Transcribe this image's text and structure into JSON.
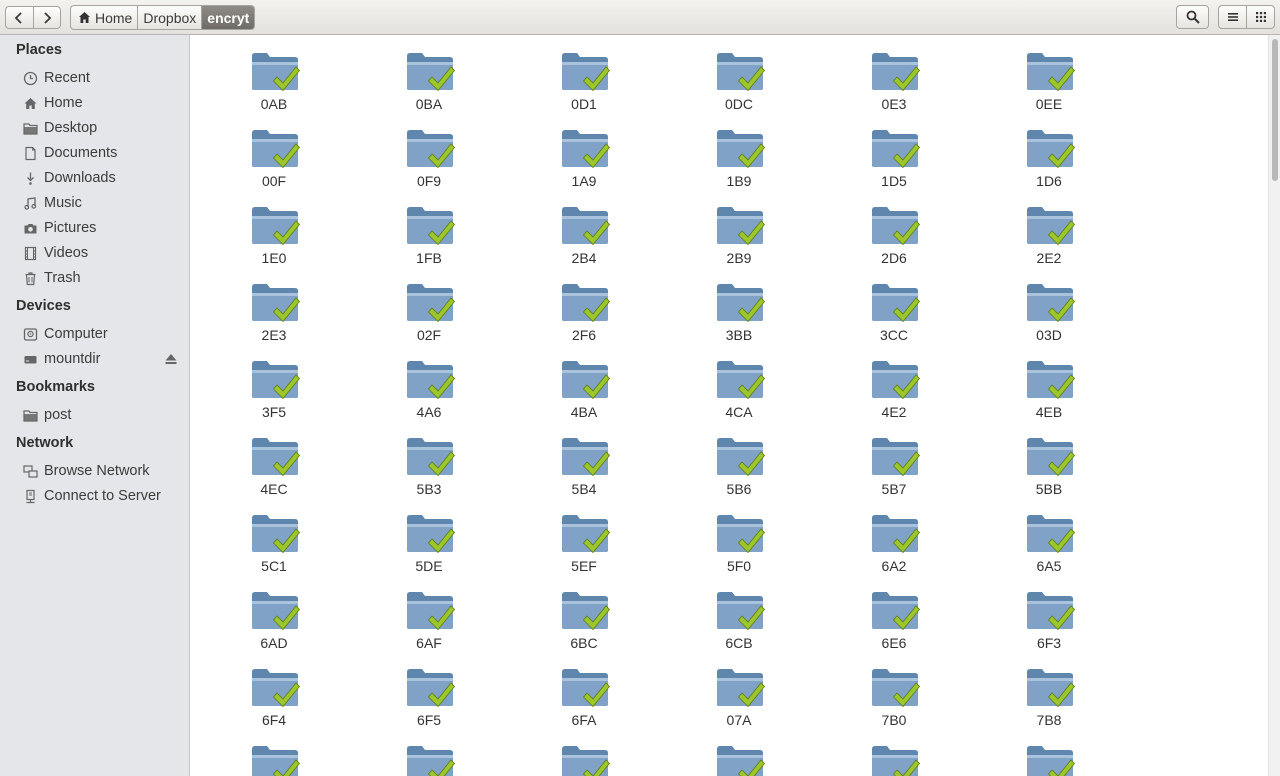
{
  "toolbar": {
    "back_icon": "go-back-icon",
    "forward_icon": "go-forward-icon",
    "breadcrumbs": [
      "Home",
      "Dropbox",
      "encryt"
    ],
    "search_icon": "search-icon",
    "list_view_icon": "list-view-icon",
    "grid_view_icon": "grid-view-icon"
  },
  "sidebar": {
    "places_title": "Places",
    "places": [
      {
        "label": "Recent",
        "icon": "clock-icon"
      },
      {
        "label": "Home",
        "icon": "home-icon"
      },
      {
        "label": "Desktop",
        "icon": "folder-icon"
      },
      {
        "label": "Documents",
        "icon": "document-icon"
      },
      {
        "label": "Downloads",
        "icon": "download-icon"
      },
      {
        "label": "Music",
        "icon": "music-icon"
      },
      {
        "label": "Pictures",
        "icon": "camera-icon"
      },
      {
        "label": "Videos",
        "icon": "film-icon"
      },
      {
        "label": "Trash",
        "icon": "trash-icon"
      }
    ],
    "devices_title": "Devices",
    "devices": [
      {
        "label": "Computer",
        "icon": "harddisk-icon"
      },
      {
        "label": "mountdir",
        "icon": "drive-icon",
        "eject_icon": "eject-icon"
      }
    ],
    "bookmarks_title": "Bookmarks",
    "bookmarks": [
      {
        "label": "post",
        "icon": "folder-icon"
      }
    ],
    "network_title": "Network",
    "network": [
      {
        "label": "Browse Network",
        "icon": "network-icon"
      },
      {
        "label": "Connect to Server",
        "icon": "server-icon"
      }
    ]
  },
  "folders": [
    "0AB",
    "0BA",
    "0D1",
    "0DC",
    "0E3",
    "0EE",
    "00F",
    "0F9",
    "1A9",
    "1B9",
    "1D5",
    "1D6",
    "1E0",
    "1FB",
    "2B4",
    "2B9",
    "2D6",
    "2E2",
    "2E3",
    "02F",
    "2F6",
    "3BB",
    "3CC",
    "03D",
    "3F5",
    "4A6",
    "4BA",
    "4CA",
    "4E2",
    "4EB",
    "4EC",
    "5B3",
    "5B4",
    "5B6",
    "5B7",
    "5BB",
    "5C1",
    "5DE",
    "5EF",
    "5F0",
    "6A2",
    "6A5",
    "6AD",
    "6AF",
    "6BC",
    "6CB",
    "6E6",
    "6F3",
    "6F4",
    "6F5",
    "6FA",
    "07A",
    "7B0",
    "7B8",
    "",
    "",
    "",
    "",
    "",
    ""
  ],
  "folder_icon": "synced-folder-icon",
  "colors": {
    "folder_blue": "#7fa2c6",
    "check_green": "#9dc62d",
    "sidebar_bg": "#e4e6ea",
    "toolbar_bg": "#e9e7e3",
    "active_crumb": "#7d7a75"
  }
}
